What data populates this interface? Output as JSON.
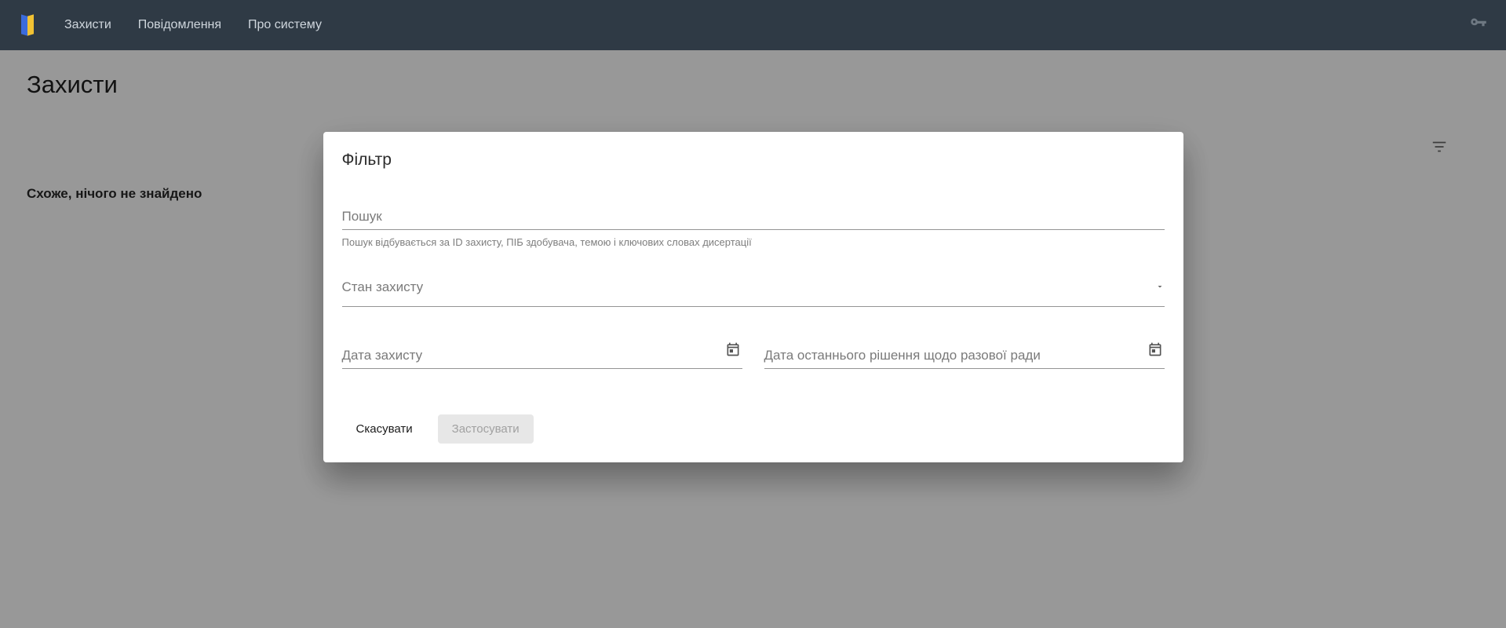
{
  "nav": {
    "items": [
      "Захисти",
      "Повідомлення",
      "Про систему"
    ]
  },
  "page": {
    "title": "Захисти",
    "empty": "Схоже, нічого не знайдено"
  },
  "dialog": {
    "title": "Фільтр",
    "search_placeholder": "Пошук",
    "search_hint": "Пошук відбувається за ID захисту, ПІБ здобувача, темою і ключових словах дисертації",
    "status_label": "Стан захисту",
    "date1_label": "Дата захисту",
    "date2_label": "Дата останнього рішення щодо разової ради",
    "cancel": "Скасувати",
    "apply": "Застосувати"
  }
}
